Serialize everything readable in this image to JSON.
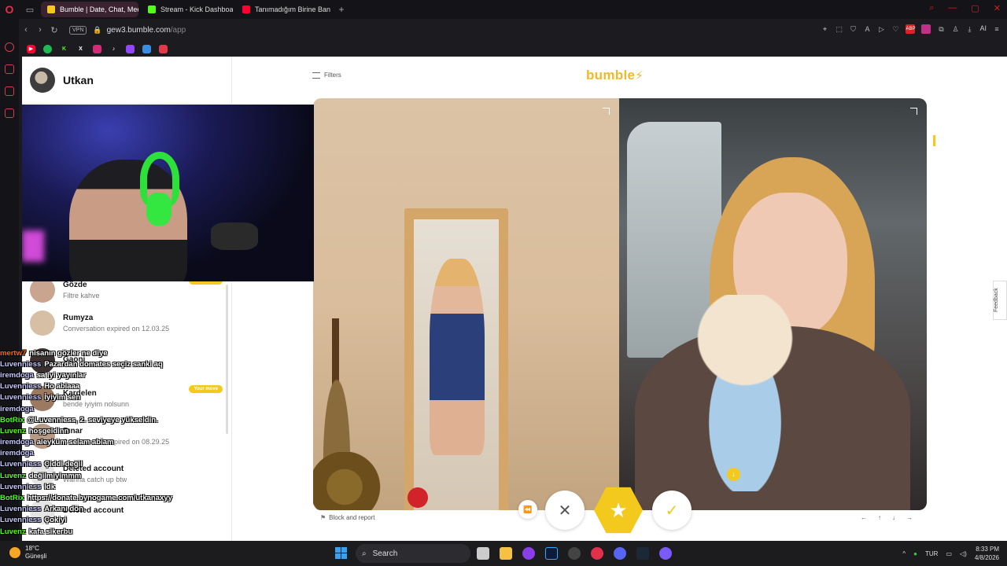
{
  "browser": {
    "tabs": [
      {
        "label": "Bumble | Date, Chat, Meet",
        "color": "#f3c91d"
      },
      {
        "label": "Stream - Kick Dashboard",
        "color": "#53fc18"
      },
      {
        "label": "Tanımadığım Birine Banka",
        "color": "#ff0033"
      }
    ],
    "url_host": "gew3.bumble.com",
    "url_path": "/app",
    "vpn_label": "VPN",
    "ai_label": "AI",
    "abp_label": "ABP"
  },
  "sidebar": {
    "username": "Utkan",
    "conversations": [
      {
        "name": "Gözde",
        "message": "Filtre kahve",
        "badge": "Your move"
      },
      {
        "name": "Rumyza",
        "message": "Conversation expired on 12.03.25"
      },
      {
        "name": "Gaoni",
        "message": ""
      },
      {
        "name": "Kardelen",
        "message": "bende iyiyim nolsunn",
        "badge": "Your move"
      },
      {
        "name": "Pınar",
        "message": "Conversation expired on 08.29.25"
      },
      {
        "name": "Deleted account",
        "message": "Wanna catch up btw"
      },
      {
        "name": "Deleted account",
        "message": ""
      }
    ]
  },
  "main": {
    "filters_label": "Filters",
    "logo_text": "bumble",
    "report_label": "Block and report",
    "feedback_label": "Feedback",
    "kbd_hints": [
      "←",
      "↑",
      "↓",
      "→"
    ]
  },
  "chat": [
    {
      "user": "mertw7",
      "msg": "nisanın gözler ne diye",
      "color": "#ff6a00"
    },
    {
      "user": "Luvenniess",
      "msg": "Pazardan domates seçiz sanki aq",
      "color": "#c7c7ff"
    },
    {
      "user": "iremdoga",
      "msg": "sa iyi yayınlar",
      "color": "#c7c7ff"
    },
    {
      "user": "Luvenniess",
      "msg": "Ho abiaaa",
      "color": "#c7c7ff"
    },
    {
      "user": "Luvenniess",
      "msg": "İyiyim sen",
      "color": "#c7c7ff"
    },
    {
      "user": "iremdoga",
      "msg": "",
      "color": "#c7c7ff"
    },
    {
      "user": "BotRix",
      "msg": "@Luvenniess, 2. seviyeye yükseldin.",
      "color": "#53fc18"
    },
    {
      "user": "Luvenz",
      "msg": "hoşgeldinn",
      "color": "#53fc18"
    },
    {
      "user": "iremdoga",
      "msg": "aleyküm selam abiam",
      "color": "#c7c7ff"
    },
    {
      "user": "iremdoga",
      "msg": "",
      "color": "#c7c7ff"
    },
    {
      "user": "Luvenniess",
      "msg": "Çiddi değil",
      "color": "#c7c7ff"
    },
    {
      "user": "Luvenz",
      "msg": "değilmiyimmm",
      "color": "#53fc18"
    },
    {
      "user": "Luvenniess",
      "msg": "Idk",
      "color": "#c7c7ff"
    },
    {
      "user": "BotRix",
      "msg": "https://donate.bynogame.com/utkanaxyy",
      "color": "#53fc18"
    },
    {
      "user": "Luvenniess",
      "msg": "Arkanı dön",
      "color": "#c7c7ff"
    },
    {
      "user": "Luvenniess",
      "msg": "Çokiyi",
      "color": "#c7c7ff"
    },
    {
      "user": "Luvenz",
      "msg": "kafa sikerbu",
      "color": "#53fc18"
    }
  ],
  "taskbar": {
    "weather_temp": "18°C",
    "weather_city": "Güneşli",
    "search_placeholder": "Search",
    "lang": "TUR",
    "time": "8:33 PM",
    "date": "4/8/2026"
  },
  "colors": {
    "bumble_yellow": "#f3c91d",
    "opera_red": "#e0304a"
  }
}
